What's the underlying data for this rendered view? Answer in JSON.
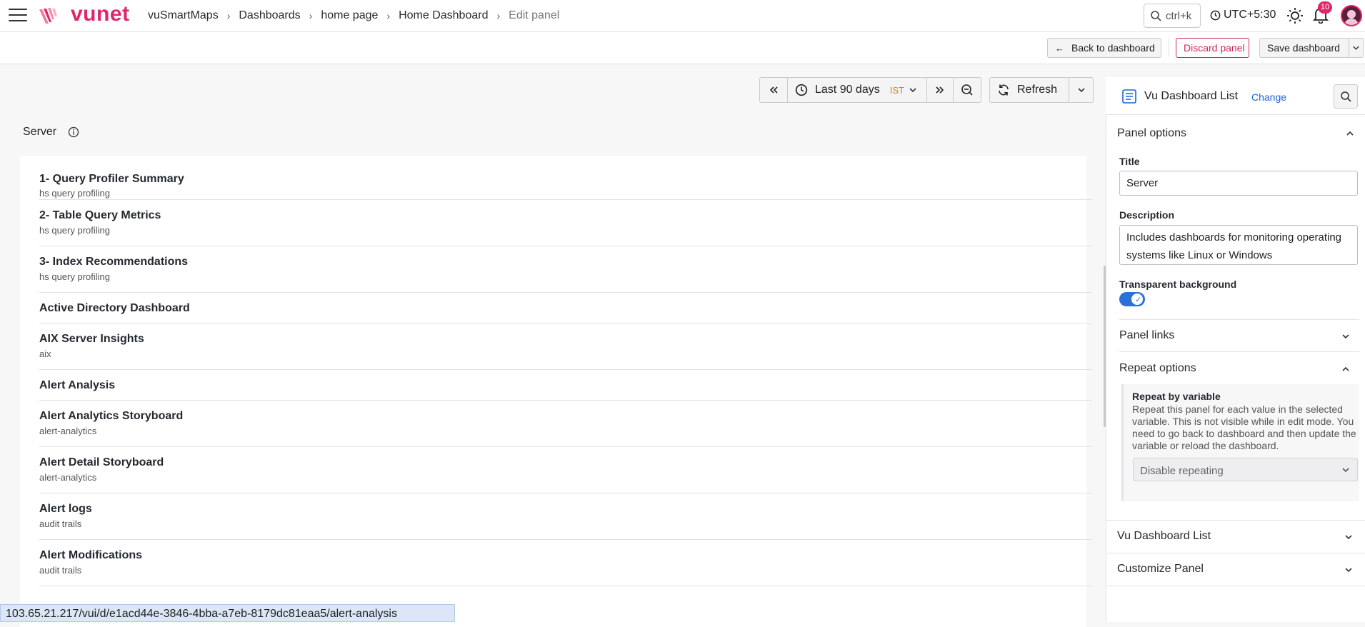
{
  "header": {
    "logo_text": "vunet",
    "breadcrumbs": [
      "vuSmartMaps",
      "Dashboards",
      "home page",
      "Home Dashboard",
      "Edit panel"
    ],
    "search_label": "ctrl+k",
    "timezone": "UTC+5:30",
    "notification_count": "10"
  },
  "toolbar": {
    "back_label": "Back to dashboard",
    "discard_label": "Discard panel",
    "save_label": "Save dashboard"
  },
  "time_controls": {
    "range_label": "Last 90 days",
    "tz_label": "IST",
    "refresh_label": "Refresh"
  },
  "panel": {
    "title": "Server",
    "items": [
      {
        "title": "1- Query Profiler Summary",
        "subtitle": "hs query profiling"
      },
      {
        "title": "2- Table Query Metrics",
        "subtitle": "hs query profiling"
      },
      {
        "title": "3- Index Recommendations",
        "subtitle": "hs query profiling"
      },
      {
        "title": "Active Directory Dashboard",
        "subtitle": ""
      },
      {
        "title": "AIX Server Insights",
        "subtitle": "aix"
      },
      {
        "title": "Alert Analysis",
        "subtitle": ""
      },
      {
        "title": "Alert Analytics Storyboard",
        "subtitle": "alert-analytics"
      },
      {
        "title": "Alert Detail Storyboard",
        "subtitle": "alert-analytics"
      },
      {
        "title": "Alert logs",
        "subtitle": "audit trails"
      },
      {
        "title": "Alert Modifications",
        "subtitle": "audit trails"
      }
    ]
  },
  "status_url": "103.65.21.217/vui/d/e1acd44e-3846-4bba-a7eb-8179dc81eaa5/alert-analysis",
  "options": {
    "viz_name": "Vu Dashboard List",
    "change_label": "Change",
    "panel_options_label": "Panel options",
    "title_label": "Title",
    "title_value": "Server",
    "description_label": "Description",
    "description_value": "Includes dashboards for monitoring operating systems like Linux or Windows",
    "transparent_label": "Transparent background",
    "transparent_on": true,
    "panel_links_label": "Panel links",
    "repeat_options_label": "Repeat options",
    "repeat_by_label": "Repeat by variable",
    "repeat_desc": "Repeat this panel for each value in the selected variable. This is not visible while in edit mode. You need to go back to dashboard and then update the variable or reload the dashboard.",
    "repeat_select_value": "Disable repeating",
    "vu_list_section": "Vu Dashboard List",
    "customize_section": "Customize Panel"
  },
  "colors": {
    "brand": "#e3256b",
    "accent": "#1b64d6",
    "toggle": "#2b6fd9"
  }
}
